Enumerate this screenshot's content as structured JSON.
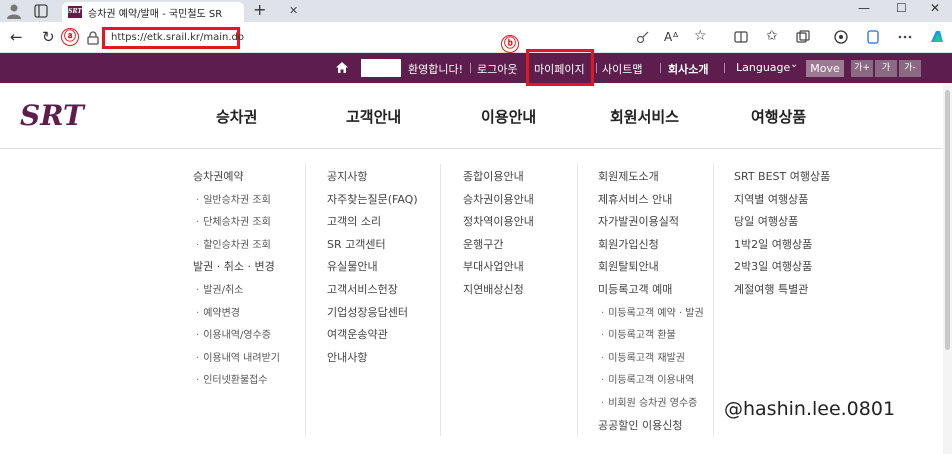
{
  "browser": {
    "tab_title": "승차권 예약/발매 - 국민철도 SR",
    "tab_favicon_text": "SRT",
    "url": "https://etk.srail.kr/main.do",
    "annotation_a": "ⓐ",
    "annotation_b": "ⓑ",
    "annotation_color": "#e2181f"
  },
  "utilbar": {
    "welcome": "환영합니다!",
    "logout": "로그아웃",
    "mypage": "마이페이지",
    "sitemap": "사이트맵",
    "company": "회사소개",
    "language": "Language",
    "move": "Move",
    "font_large": "가+",
    "font_normal": "가",
    "font_small": "가-",
    "bg_color": "#5d1e4e"
  },
  "mainnav": {
    "logo": "SRT",
    "menus": [
      "승차권",
      "고객안내",
      "이용안내",
      "회원서비스",
      "여행상품"
    ]
  },
  "submenu": {
    "col1": [
      {
        "label": "승차권예약",
        "sub": false
      },
      {
        "label": "일반승차권 조회",
        "sub": true
      },
      {
        "label": "단체승차권 조회",
        "sub": true
      },
      {
        "label": "할인승차권 조회",
        "sub": true
      },
      {
        "label": "발권 · 취소 · 변경",
        "sub": false
      },
      {
        "label": "발권/취소",
        "sub": true
      },
      {
        "label": "예약변경",
        "sub": true
      },
      {
        "label": "이용내역/영수증",
        "sub": true
      },
      {
        "label": "이용내역 내려받기",
        "sub": true
      },
      {
        "label": "인터넷환불접수",
        "sub": true
      }
    ],
    "col2": [
      {
        "label": "공지사항",
        "sub": false
      },
      {
        "label": "자주찾는질문(FAQ)",
        "sub": false
      },
      {
        "label": "고객의 소리",
        "sub": false
      },
      {
        "label": "SR 고객센터",
        "sub": false
      },
      {
        "label": "유실물안내",
        "sub": false
      },
      {
        "label": "고객서비스헌장",
        "sub": false
      },
      {
        "label": "기업성장응답센터",
        "sub": false
      },
      {
        "label": "여객운송약관",
        "sub": false
      },
      {
        "label": "안내사항",
        "sub": false
      }
    ],
    "col3": [
      {
        "label": "종합이용안내",
        "sub": false
      },
      {
        "label": "승차권이용안내",
        "sub": false
      },
      {
        "label": "정차역이용안내",
        "sub": false
      },
      {
        "label": "운행구간",
        "sub": false
      },
      {
        "label": "부대사업안내",
        "sub": false
      },
      {
        "label": "지연배상신청",
        "sub": false
      }
    ],
    "col4": [
      {
        "label": "회원제도소개",
        "sub": false
      },
      {
        "label": "제휴서비스 안내",
        "sub": false
      },
      {
        "label": "자가발권이용실적",
        "sub": false
      },
      {
        "label": "회원가입신청",
        "sub": false
      },
      {
        "label": "회원탈퇴안내",
        "sub": false
      },
      {
        "label": "미등록고객 예매",
        "sub": false
      },
      {
        "label": "미등록고객 예약 · 발권",
        "sub": true
      },
      {
        "label": "미등록고객 환불",
        "sub": true
      },
      {
        "label": "미등록고객 재발권",
        "sub": true
      },
      {
        "label": "미등록고객 이용내역",
        "sub": true
      },
      {
        "label": "비회원 승차권 영수증",
        "sub": true
      },
      {
        "label": "공공할인 이용신청",
        "sub": false
      }
    ],
    "col5": [
      {
        "label": "SRT BEST 여행상품",
        "sub": false
      },
      {
        "label": "지역별 여행상품",
        "sub": false
      },
      {
        "label": "당일 여행상품",
        "sub": false
      },
      {
        "label": "1박2일 여행상품",
        "sub": false
      },
      {
        "label": "2박3일 여행상품",
        "sub": false
      },
      {
        "label": "계절여행 특별관",
        "sub": false
      }
    ]
  },
  "watermark": "@hashin.lee.0801"
}
